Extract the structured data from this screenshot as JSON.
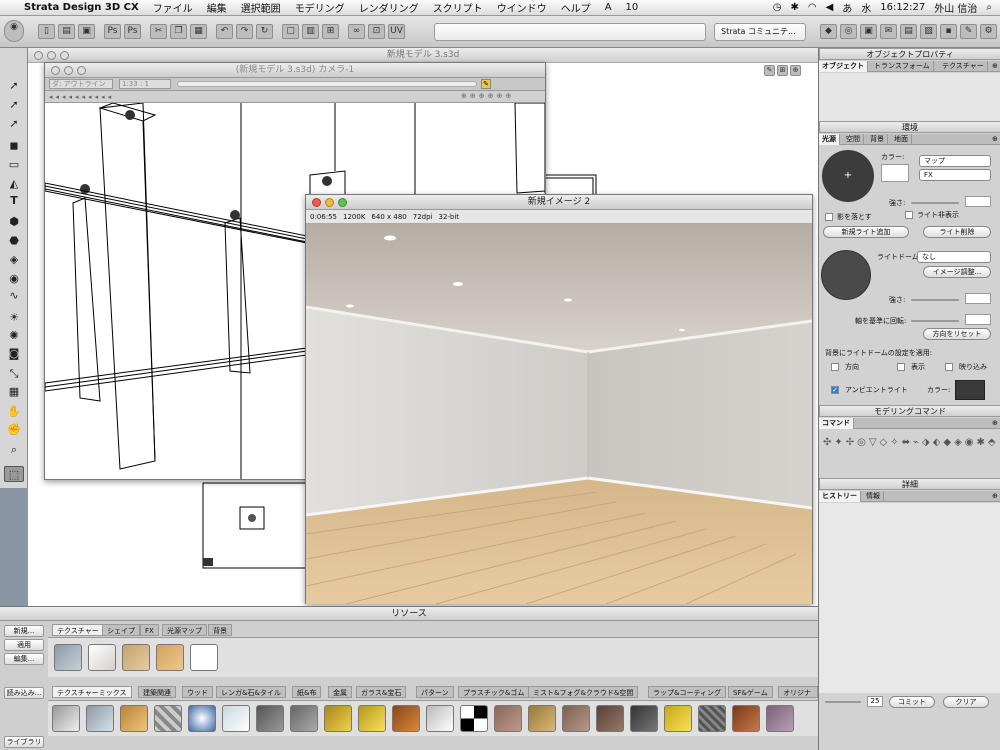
{
  "menubar": {
    "app": "Strata Design 3D CX",
    "items": [
      "ファイル",
      "編集",
      "選択範囲",
      "モデリング",
      "レンダリング",
      "スクリプト",
      "ウインドウ",
      "ヘルプ"
    ],
    "badge": "10",
    "day": "水",
    "clock": "16:12:27",
    "user": "外山 信治"
  },
  "toolbar": {
    "community": "Strata コミュニテ..."
  },
  "bg_window": {
    "title": "新規モデル 3.s3d"
  },
  "camera_window": {
    "title": "(新規モデル 3.s3d) カメラ-1",
    "view_mode": "ダ: アウトライン",
    "scale": "1:33 : 1"
  },
  "render_window": {
    "title": "新規イメージ 2",
    "time": "0:06:55",
    "memory": "1200K",
    "size": "640 x 480",
    "dpi": "72dpi",
    "bit": "32-bit"
  },
  "object_props": {
    "title": "オブジェクトプロパティ",
    "tabs": [
      "オブジェクト",
      "トランスフォーム",
      "テクスチャー"
    ]
  },
  "environment": {
    "title": "環境",
    "tabs": [
      "光源",
      "空間",
      "背景",
      "地面"
    ],
    "color_label": "カラー:",
    "map_select": "マップ",
    "fx_select": "FX",
    "intensity_label": "強さ:",
    "cast_shadow": "影を落とす",
    "hide_light": "ライト非表示",
    "add_light": "新規ライト追加",
    "delete_light": "ライト削除",
    "light_dome_label": "ライトドーム:",
    "light_dome_value": "なし",
    "image_adjust": "イメージ調整...",
    "intensity_label2": "強さ:",
    "rotate_label": "軸を基準に回転:",
    "reset_dir": "方向をリセット",
    "apply_label": "背景にライトドームの設定を適用:",
    "opt_dir": "方向",
    "opt_show": "表示",
    "opt_reflect": "映り込み",
    "ambient": "アンビエントライト",
    "ambient_color": "カラー:"
  },
  "modeling": {
    "title": "モデリングコマンド",
    "tab": "コマンド"
  },
  "details": {
    "title": "詳細",
    "tabs": [
      "ヒストリー",
      "情報"
    ],
    "value": "25",
    "commit": "コミット",
    "clear": "クリア"
  },
  "resources": {
    "title": "リソース",
    "new_btn": "新規...",
    "apply_btn": "適用",
    "edit_btn": "編集...",
    "load_btn": "読み込み...",
    "library_btn": "ライブラリ",
    "tabs": [
      "テクスチャー",
      "シェイプ",
      "FX",
      "光源マップ",
      "背景"
    ],
    "lib_tabs": [
      "テクスチャーミックス",
      "建築関連",
      "ウッド",
      "レンガ&石&タイル",
      "紙&布",
      "金属",
      "ガラス&宝石",
      "パターン",
      "プラスチック&ゴム",
      "ミスト&フォグ&クラウド&空間",
      "ラップ&コーティング",
      "SF&ゲーム",
      "オリジナルテ"
    ]
  },
  "colors": {
    "ambient_swatch": "#3a3a3a",
    "light_preview": "#3c3c3c",
    "dome_preview": "#4a4a4a"
  }
}
